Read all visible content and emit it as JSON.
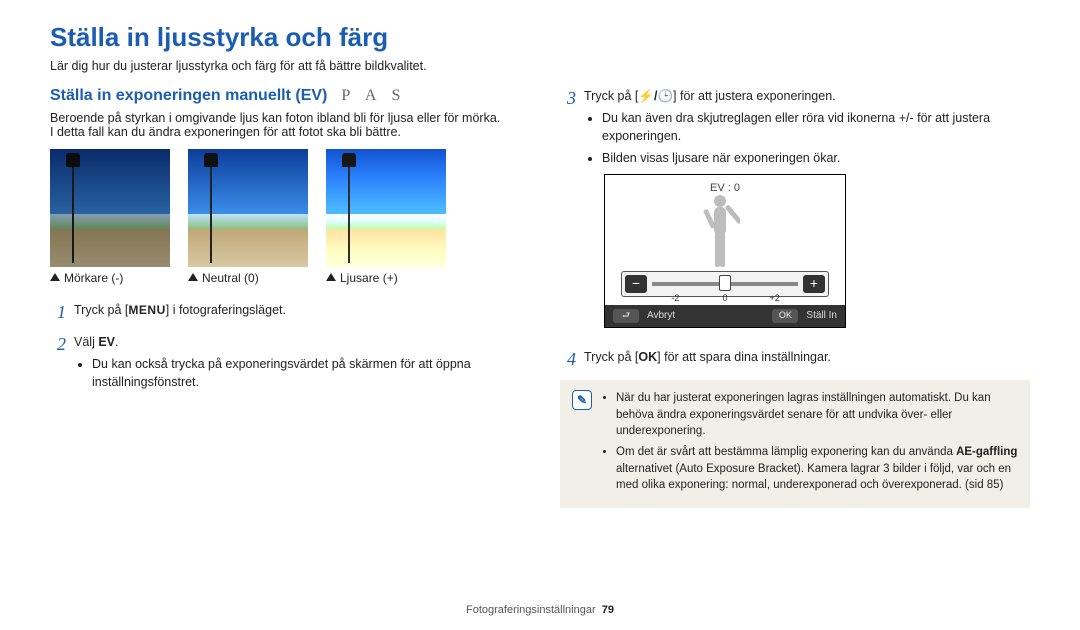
{
  "title": "Ställa in ljusstyrka och färg",
  "intro": "Lär dig hur du justerar ljusstyrka och färg för att få bättre bildkvalitet.",
  "left": {
    "subheading": "Ställa in exponeringen manuellt (EV)",
    "modes": "P A S",
    "body1": "Beroende på styrkan i omgivande ljus kan foton ibland bli för ljusa eller för mörka.",
    "body2": "I detta fall kan du ändra exponeringen för att fotot ska bli bättre.",
    "captions": [
      "Mörkare (-)",
      "Neutral (0)",
      "Ljusare (+)"
    ],
    "step1_pre": "Tryck på [",
    "step1_menu": "MENU",
    "step1_post": "] i fotograferingsläget.",
    "step2_pre": "Välj ",
    "step2_bold": "EV",
    "step2_post": ".",
    "step2_bullet": "Du kan också trycka på exponeringsvärdet på skärmen för att öppna inställningsfönstret."
  },
  "right": {
    "step3_pre": "Tryck på [",
    "step3_icons": "⚡/🕒",
    "step3_post": "] för att justera exponeringen.",
    "step3_b1": "Du kan även dra skjutreglagen eller röra vid ikonerna +/- för att justera exponeringen.",
    "step3_b2": "Bilden visas ljusare när exponeringen ökar.",
    "ui": {
      "ev_label": "EV : 0",
      "tick_l": "-2",
      "tick_m": "0",
      "tick_r": "+2",
      "back_key": "⮐",
      "back_label": "Avbryt",
      "ok_key": "OK",
      "ok_label": "Ställ In"
    },
    "step4_pre": "Tryck på [",
    "step4_key": "OK",
    "step4_post": "] för att spara dina inställningar.",
    "notes": [
      "När du har justerat exponeringen lagras inställningen automatiskt. Du kan behöva ändra exponeringsvärdet senare för att undvika över- eller underexponering.",
      "Om det är svårt att bestämma lämplig exponering kan du använda AE-gaffling alternativet (Auto Exposure Bracket). Kamera lagrar 3 bilder i följd, var och en med olika exponering: normal, underexponerad och överexponerad. (sid 85)"
    ],
    "note_bold": "AE-gaffling"
  },
  "footer": {
    "section": "Fotograferingsinställningar",
    "page": "79"
  }
}
